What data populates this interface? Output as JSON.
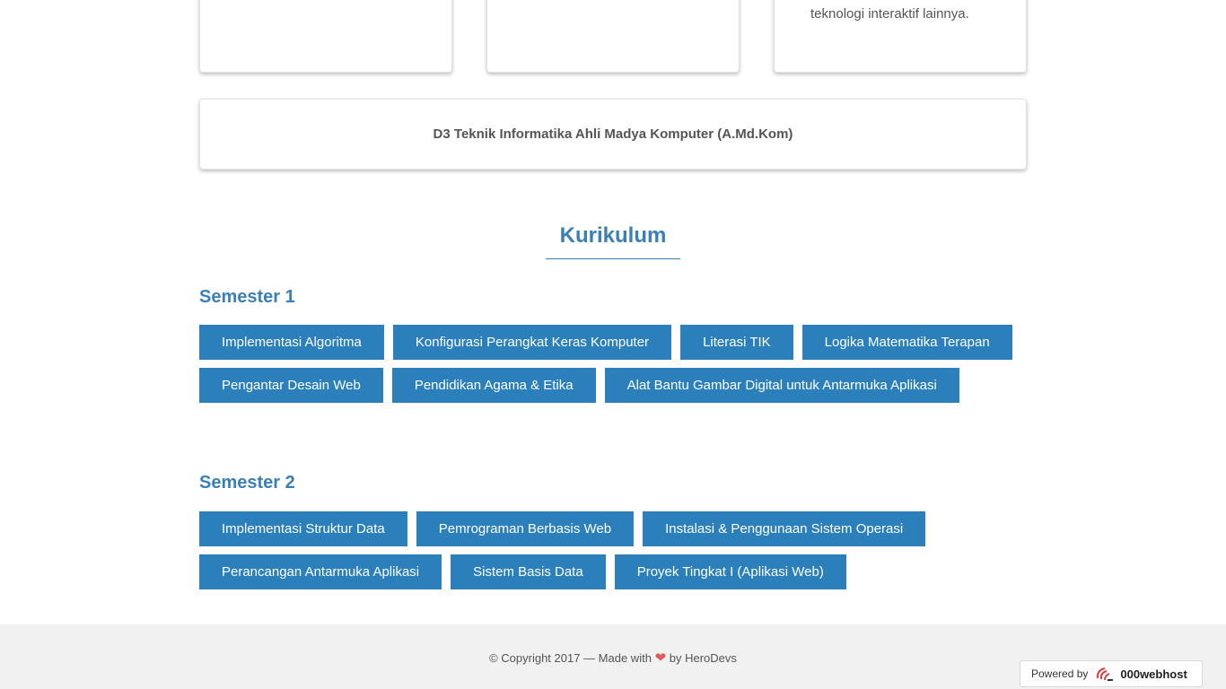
{
  "top_cards": [
    {
      "text": ""
    },
    {
      "text": ""
    },
    {
      "text": "teknologi interaktif lainnya."
    }
  ],
  "degree": "D3 Teknik Informatika Ahli Madya Komputer (A.Md.Kom)",
  "curriculum": {
    "title": "Kurikulum",
    "semesters": [
      {
        "title": "Semester 1",
        "courses": [
          "Implementasi Algoritma",
          "Konfigurasi Perangkat Keras Komputer",
          "Literasi TIK",
          "Logika Matematika Terapan",
          "Pengantar Desain Web",
          "Pendidikan Agama & Etika",
          "Alat Bantu Gambar Digital untuk Antarmuka Aplikasi"
        ]
      },
      {
        "title": "Semester 2",
        "courses": [
          "Implementasi Struktur Data",
          "Pemrograman Berbasis Web",
          "Instalasi & Penggunaan Sistem Operasi",
          "Perancangan Antarmuka Aplikasi",
          "Sistem Basis Data",
          "Proyek Tingkat I (Aplikasi Web)"
        ]
      }
    ]
  },
  "footer": {
    "prefix": "© Copyright 2017 — Made with",
    "heart_icon": "heart-icon",
    "suffix": "by HeroDevs"
  },
  "badge": {
    "powered_label": "Powered by",
    "brand": "000webhost",
    "logo_icon": "webhost-logo-icon"
  },
  "colors": {
    "accent": "#2b80bb",
    "heading": "#3a7fb8",
    "footer_bg": "#f1f1f1",
    "heart": "#e05a5a"
  }
}
